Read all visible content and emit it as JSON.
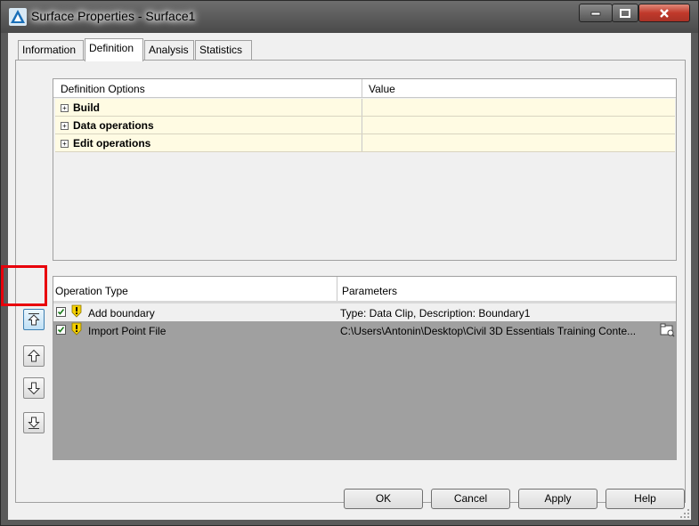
{
  "window": {
    "title": "Surface Properties - Surface1",
    "app_icon": "civil3d-icon",
    "controls": [
      "minimize-icon",
      "maximize-icon",
      "close-icon"
    ]
  },
  "tabs": [
    {
      "label": "Information",
      "active": false
    },
    {
      "label": "Definition",
      "active": true
    },
    {
      "label": "Analysis",
      "active": false
    },
    {
      "label": "Statistics",
      "active": false
    }
  ],
  "definition_grid": {
    "headers": [
      "Definition Options",
      "Value"
    ],
    "rows": [
      {
        "label": "Build",
        "value": ""
      },
      {
        "label": "Data operations",
        "value": ""
      },
      {
        "label": "Edit operations",
        "value": ""
      }
    ]
  },
  "operations_grid": {
    "headers": [
      "Operation Type",
      "Parameters"
    ],
    "rows": [
      {
        "checked": true,
        "icon": "warning-icon",
        "type": "Add boundary",
        "parameters": "Type: Data Clip,  Description: Boundary1",
        "selected": true
      },
      {
        "checked": true,
        "icon": "warning-icon",
        "type": "Import Point File",
        "parameters": "C:\\Users\\Antonin\\Desktop\\Civil 3D Essentials Training Conte...",
        "selected": false,
        "has_browse": true
      }
    ]
  },
  "side_buttons": [
    "move-to-top-icon",
    "move-up-icon",
    "move-down-icon",
    "move-to-bottom-icon"
  ],
  "buttons": {
    "ok": "OK",
    "cancel": "Cancel",
    "apply": "Apply",
    "help": "Help"
  },
  "colors": {
    "highlight_box": "#e8000b",
    "option_row_bg": "#fffbe3",
    "empty_grid_bg": "#a0a0a0"
  }
}
